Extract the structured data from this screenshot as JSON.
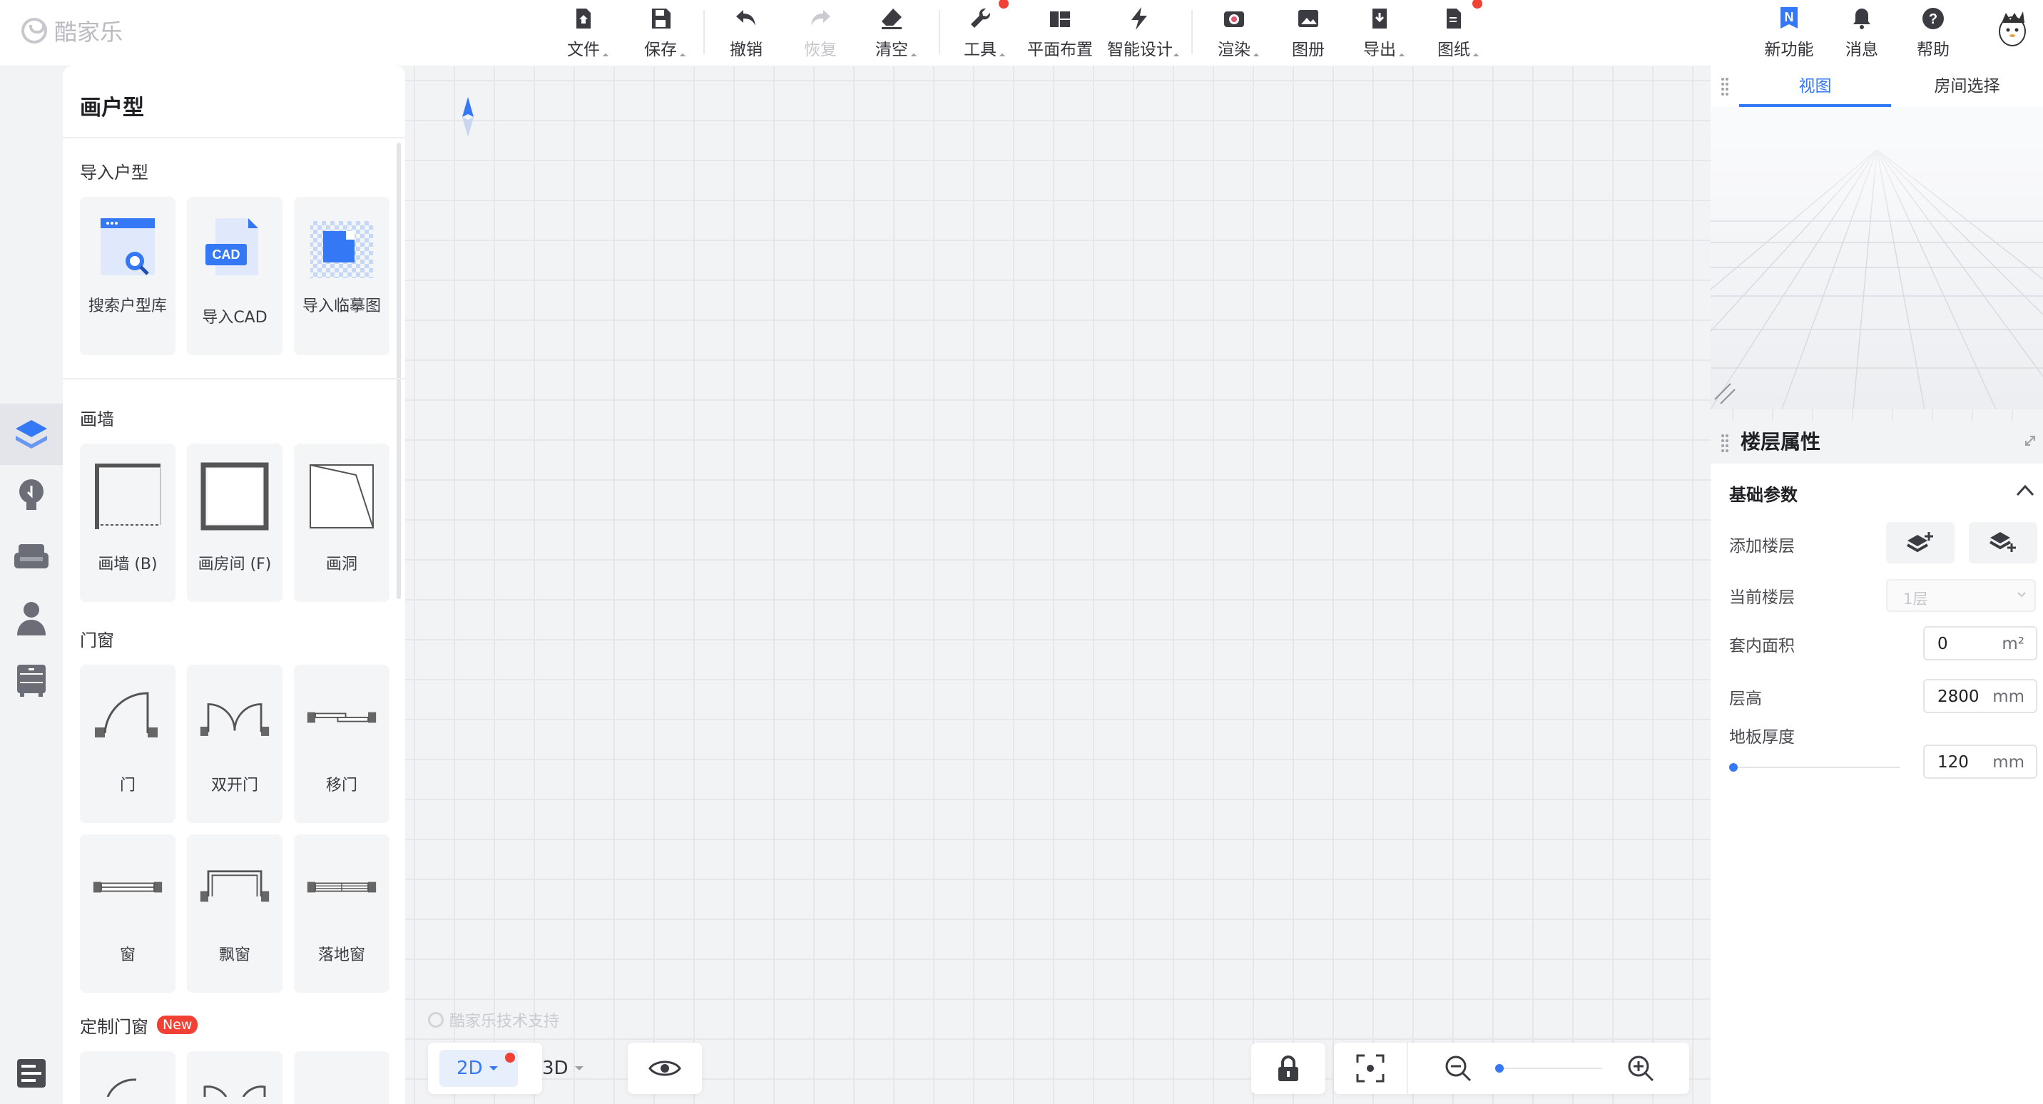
{
  "app": {
    "logo_text": "酷家乐"
  },
  "toolbar": {
    "file": "文件",
    "save": "保存",
    "undo": "撤销",
    "redo": "恢复",
    "clear": "清空",
    "tools": "工具",
    "layout": "平面布置",
    "smart": "智能设计",
    "render": "渲染",
    "album": "图册",
    "export": "导出",
    "drawings": "图纸",
    "new_features": "新功能",
    "messages": "消息",
    "help": "帮助"
  },
  "left_panel": {
    "title": "画户型",
    "import_section": "导入户型",
    "import_items": [
      "搜索户型库",
      "导入CAD",
      "导入临摹图"
    ],
    "cad_badge": "CAD",
    "wall_section": "画墙",
    "wall_items": [
      "画墙 (B)",
      "画房间 (F)",
      "画洞"
    ],
    "door_section": "门窗",
    "door_items": [
      "门",
      "双开门",
      "移门"
    ],
    "window_items": [
      "窗",
      "飘窗",
      "落地窗"
    ],
    "custom_section": "定制门窗",
    "new_badge": "New"
  },
  "view_panel": {
    "tabs": [
      "视图",
      "房间选择"
    ],
    "active_tab": 0
  },
  "property_panel": {
    "title": "楼层属性",
    "group": "基础参数",
    "add_floor": "添加楼层",
    "current_floor": "当前楼层",
    "current_floor_value": "1层",
    "inner_area": "套内面积",
    "inner_area_value": "0",
    "inner_area_unit": "m²",
    "floor_height": "层高",
    "floor_height_value": "2800",
    "floor_height_unit": "mm",
    "floor_thickness": "地板厚度",
    "floor_thickness_value": "120",
    "floor_thickness_unit": "mm"
  },
  "bottom": {
    "mode_2d": "2D",
    "mode_3d": "3D",
    "watermark": "酷家乐技术支持",
    "zoom_level": 0.0
  },
  "colors": {
    "accent": "#3478f6",
    "badge": "#f04134"
  }
}
